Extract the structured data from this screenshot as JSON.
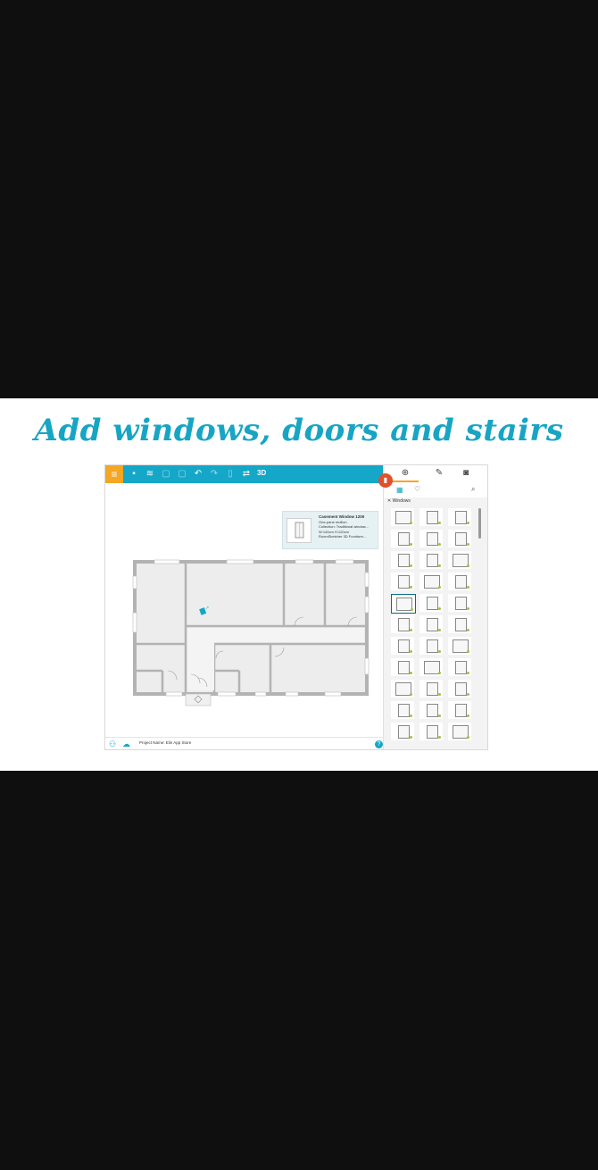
{
  "headline": "Add windows, doors and stairs",
  "toolbar": {
    "menu_icon": "≡",
    "threed_label": "3D"
  },
  "tooltip": {
    "title": "Casement Window 1200",
    "line1": "One-pane mullion",
    "line2": "Collection: Traditional window...",
    "line3": "W:140cm H:120cm",
    "line4": "RoomSketcher 3D Furniture..."
  },
  "panel": {
    "category": "Windows"
  },
  "status": {
    "project_name": "Project Name: Elin App Store"
  },
  "colors": {
    "accent": "#14a7c8",
    "menu": "#f5a623",
    "badge": "#e0512b",
    "headline": "#17a5c4"
  }
}
